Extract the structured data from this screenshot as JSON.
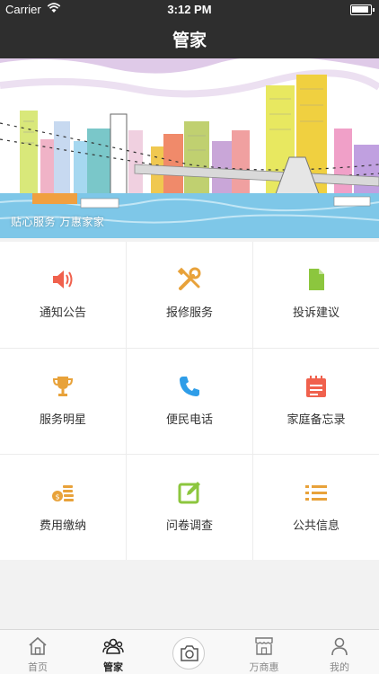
{
  "status_bar": {
    "carrier": "Carrier",
    "time": "3:12 PM"
  },
  "header": {
    "title": "管家"
  },
  "banner": {
    "caption": "贴心服务 万惠家家"
  },
  "services": [
    {
      "label": "通知公告",
      "icon": "speaker-icon",
      "color": "#f0614d"
    },
    {
      "label": "报修服务",
      "icon": "tools-icon",
      "color": "#e8a23a"
    },
    {
      "label": "投诉建议",
      "icon": "document-icon",
      "color": "#8cc63e"
    },
    {
      "label": "服务明星",
      "icon": "trophy-icon",
      "color": "#e8a23a"
    },
    {
      "label": "便民电话",
      "icon": "phone-icon",
      "color": "#2e9de8"
    },
    {
      "label": "家庭备忘录",
      "icon": "calendar-icon",
      "color": "#f0614d"
    },
    {
      "label": "费用缴纳",
      "icon": "coins-icon",
      "color": "#e8a23a"
    },
    {
      "label": "问卷调查",
      "icon": "edit-icon",
      "color": "#8cc63e"
    },
    {
      "label": "公共信息",
      "icon": "list-icon",
      "color": "#e8a23a"
    }
  ],
  "tabbar": {
    "items": [
      {
        "label": "首页",
        "icon": "home-icon"
      },
      {
        "label": "管家",
        "icon": "users-icon",
        "active": true
      },
      {
        "label": "",
        "icon": "camera-icon"
      },
      {
        "label": "万商惠",
        "icon": "shop-icon"
      },
      {
        "label": "我的",
        "icon": "person-icon"
      }
    ]
  }
}
